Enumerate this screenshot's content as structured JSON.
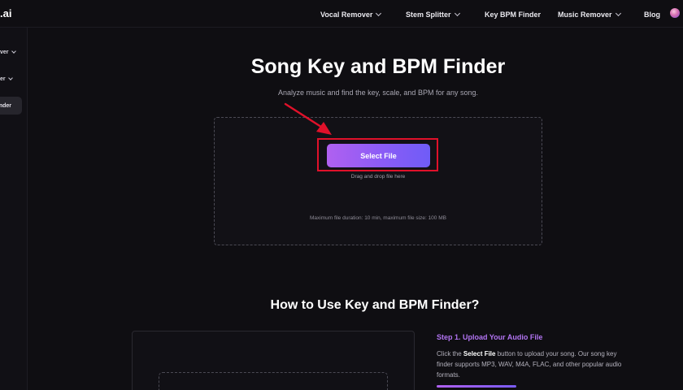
{
  "brand": {
    "logo_text": ".ai"
  },
  "nav": {
    "items": [
      {
        "label": "Vocal Remover",
        "has_dropdown": true
      },
      {
        "label": "Stem Splitter",
        "has_dropdown": true
      },
      {
        "label": "Key BPM Finder",
        "has_dropdown": false
      },
      {
        "label": "Music Remover",
        "has_dropdown": true
      },
      {
        "label": "Blog",
        "has_dropdown": false
      }
    ]
  },
  "sidebar": {
    "items": [
      {
        "label": "ver"
      },
      {
        "label": "er"
      }
    ],
    "active_label": "inder"
  },
  "hero": {
    "title": "Song Key and BPM Finder",
    "subtitle": "Analyze music and find the key, scale, and BPM for any song."
  },
  "upload": {
    "button_label": "Select File",
    "drag_text": "Drag and drop file here",
    "limit_text": "Maximum file duration: 10 min, maximum file size: 100 MB"
  },
  "howto": {
    "title": "How to Use Key and BPM Finder?",
    "step_title": "Step 1. Upload Your Audio File",
    "step_desc_prefix": "Click the ",
    "step_desc_bold": "Select File",
    "step_desc_suffix": " button to upload your song. Our song key finder supports MP3, WAV, M4A, FLAC, and other popular audio formats."
  },
  "colors": {
    "background": "#0f0e12",
    "accent_start": "#b060f0",
    "accent_end": "#6f5cf7",
    "highlight_red": "#e0112a",
    "step_title": "#b274f2"
  }
}
